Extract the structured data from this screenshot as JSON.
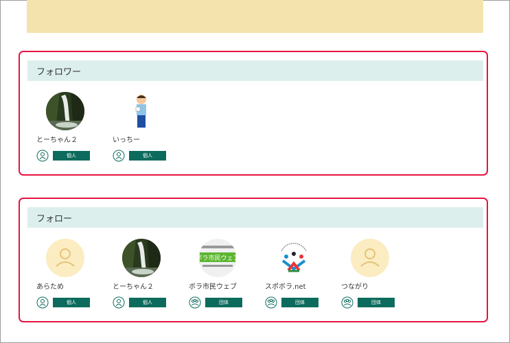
{
  "followers": {
    "title": "フォロワー",
    "items": [
      {
        "name": "とーちゃん２",
        "type": "個人",
        "avatar": "waterfall-photo"
      },
      {
        "name": "いっちー",
        "type": "個人",
        "avatar": "illustrated-person"
      }
    ]
  },
  "following": {
    "title": "フォロー",
    "items": [
      {
        "name": "あらため",
        "type": "個人",
        "avatar": "default-user"
      },
      {
        "name": "とーちゃん２",
        "type": "個人",
        "avatar": "waterfall-photo"
      },
      {
        "name": "ボラ市民ウェブ",
        "type": "団体",
        "avatar": "borashimin-web-logo",
        "logo_text": "ボラ市民ウェブ"
      },
      {
        "name": "スポボラ.net",
        "type": "団体",
        "avatar": "spobora-logo"
      },
      {
        "name": "つながり",
        "type": "団体",
        "avatar": "default-user"
      }
    ]
  },
  "colors": {
    "highlight": "#e5123f",
    "badge": "#0d6b5d",
    "header_bg": "#dcefed",
    "banner": "#f4e3ad"
  }
}
